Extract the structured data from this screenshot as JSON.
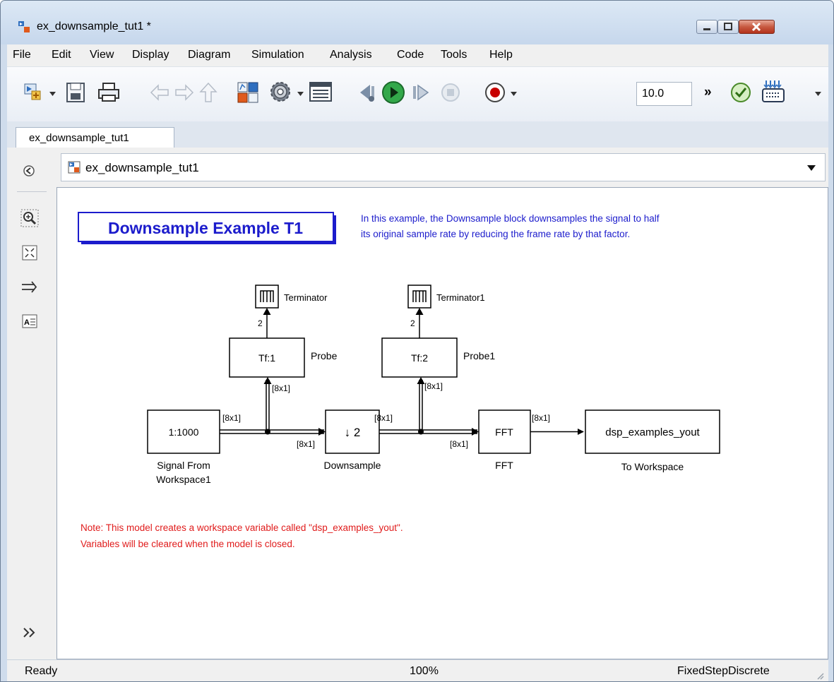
{
  "window": {
    "title": "ex_downsample_tut1 *"
  },
  "menu": [
    "File",
    "Edit",
    "View",
    "Display",
    "Diagram",
    "Simulation",
    "Analysis",
    "Code",
    "Tools",
    "Help"
  ],
  "toolbar": {
    "stop_time": "10.0",
    "overflow": "»"
  },
  "tab": {
    "label": "ex_downsample_tut1"
  },
  "address": {
    "path": "ex_downsample_tut1"
  },
  "diagram": {
    "title": "Downsample Example T1",
    "description_line1": "In this example, the Downsample block downsamples the signal to half",
    "description_line2": "its original sample rate by reducing the frame rate by that factor.",
    "note_line1": "Note: This model creates a workspace variable called \"dsp_examples_yout\".",
    "note_line2": "Variables will be cleared when the model is closed.",
    "blocks": {
      "source_value": "1:1000",
      "source_name_line1": "Signal From",
      "source_name_line2": "Workspace1",
      "downsample_value": "↓ 2",
      "downsample_name": "Downsample",
      "fft_value": "FFT",
      "fft_name": "FFT",
      "sink_value": "dsp_examples_yout",
      "sink_name": "To Workspace",
      "probe_value": "Tf:1",
      "probe_name": "Probe",
      "probe1_value": "Tf:2",
      "probe1_name": "Probe1",
      "terminator_name": "Terminator",
      "terminator1_name": "Terminator1"
    },
    "signal_labels": {
      "src_out": "[8x1]",
      "ds_in": "[8x1]",
      "probe_in": "[8x1]",
      "ds_out": "[8x1]",
      "fft_in": "[8x1]",
      "probe1_in": "[8x1]",
      "fft_out": "[8x1]",
      "probe_out": "2",
      "probe1_out": "2"
    }
  },
  "status": {
    "left": "Ready",
    "zoom": "100%",
    "solver": "FixedStepDiscrete"
  },
  "colors": {
    "diagram_blue": "#1c1ccc",
    "note_red": "#e01b1b"
  }
}
